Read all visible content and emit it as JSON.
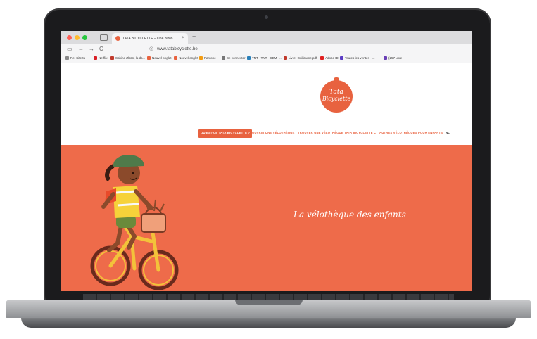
{
  "browser": {
    "tab_title": "TATA BICYCLETTE – Une biblio",
    "tab_close": "×",
    "new_tab": "+",
    "url": "www.tatabicyclette.be",
    "nav": {
      "back": "←",
      "forward": "→",
      "reload": "C"
    },
    "bookmarks": [
      {
        "label": "Re: Site tu",
        "color": "#888888"
      },
      {
        "label": "Netflix",
        "color": "#d81f26"
      },
      {
        "label": "Sabine Zlatin, la da...",
        "color": "#c0392b"
      },
      {
        "label": "Nouvel onglet",
        "color": "#e8623f"
      },
      {
        "label": "Nouvel onglet",
        "color": "#e8623f"
      },
      {
        "label": "Pantone",
        "color": "#f39c12"
      },
      {
        "label": "Se connecter",
        "color": "#777777"
      },
      {
        "label": "TNT - TNT - CEM - ...",
        "color": "#2980b9"
      },
      {
        "label": "Livret-Guillaume.pdf",
        "color": "#c0392b"
      },
      {
        "label": "Adobe ID",
        "color": "#e02020"
      },
      {
        "label": "Toutes les ventes - ...",
        "color": "#5b3cc4"
      },
      {
        "label": "(257 unre",
        "color": "#6a3fb5"
      }
    ]
  },
  "site": {
    "logo_line1": "Tata",
    "logo_line2": "Bicyclette",
    "nav": [
      "QU'EST-CE TATA BICYCLETTE ?",
      "OUVRIR UNE VÉLOTHÈQUE",
      "TROUVER UNE VÉLOTHÈQUE TATA BICYCLETTE ⌄",
      "AUTRES VÉLOTHÈQUES POUR ENFANTS"
    ],
    "lang": "NL",
    "tagline": "La vélothèque des enfants",
    "accent": "#ee6b4a"
  }
}
